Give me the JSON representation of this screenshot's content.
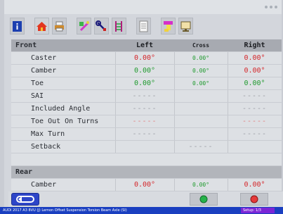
{
  "toolbar": {
    "icons": [
      "info-icon",
      "home-icon",
      "printer-icon",
      "wrench-icon",
      "adjust-icon",
      "measure-icon",
      "document-icon",
      "paint-icon",
      "monitor-icon"
    ]
  },
  "table": {
    "columns": [
      "",
      "Left",
      "Cross",
      "Right"
    ],
    "sections": {
      "front": "Front",
      "rear": "Rear"
    },
    "rows": [
      {
        "label": "Caster",
        "left": "0.00°",
        "cross": "0.00°",
        "right": "0.00°"
      },
      {
        "label": "Camber",
        "left": "0.00°",
        "cross": "0.00°",
        "right": "0.00°"
      },
      {
        "label": "Toe",
        "left": "0.00°",
        "cross": "0.00°",
        "right": "0.00°"
      },
      {
        "label": "SAI",
        "left": "-----",
        "cross": "",
        "right": "-----"
      },
      {
        "label": "Included Angle",
        "left": "-----",
        "cross": "",
        "right": "-----"
      },
      {
        "label": "Toe Out On Turns",
        "left": "-----",
        "cross": "",
        "right": "-----"
      },
      {
        "label": "Max Turn",
        "left": "-----",
        "cross": "",
        "right": "-----"
      },
      {
        "label": "Setback",
        "left": "",
        "cross": "-----",
        "right": ""
      }
    ],
    "rear_rows": [
      {
        "label": "Camber",
        "left": "0.00°",
        "cross": "0.00°",
        "right": "0.00°"
      }
    ]
  },
  "status_bar": {
    "text": "AUDI 2017 A3 8VU (J) Lemon Offset Suspension Torsion Beam Axle (SI)",
    "right_box": "Setup: 1/3"
  },
  "colors": {
    "value_red": "#d4262a",
    "value_green": "#1f9a2e",
    "back_button_blue": "#2d45c8"
  }
}
